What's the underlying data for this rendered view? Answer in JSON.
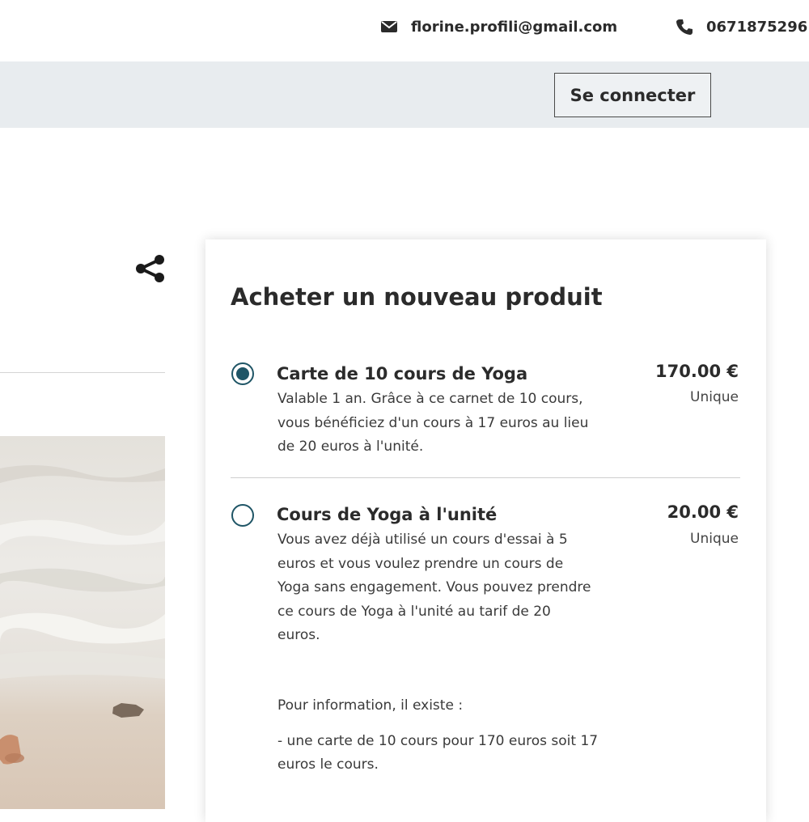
{
  "topbar": {
    "email": "florine.profili@gmail.com",
    "phone": "0671875296",
    "email_icon": "envelope-icon",
    "phone_icon": "phone-icon"
  },
  "navbar": {
    "login_label": "Se connecter"
  },
  "share_icon": "share-icon",
  "purchase": {
    "title": "Acheter un nouveau produit",
    "products": [
      {
        "name": "Carte de 10 cours de Yoga",
        "price": "170.00 €",
        "frequency": "Unique",
        "selected": true,
        "description": [
          "Valable 1 an. Grâce à ce carnet de 10 cours,",
          "vous bénéficiez d'un cours à 17 euros au lieu",
          "de 20 euros à l'unité."
        ]
      },
      {
        "name": "Cours de Yoga à l'unité",
        "price": "20.00 €",
        "frequency": "Unique",
        "selected": false,
        "description": [
          "Vous avez déjà utilisé un cours d'essai à 5",
          "euros et vous voulez prendre un cours de",
          "Yoga sans engagement. Vous pouvez prendre",
          "ce cours de Yoga à l'unité au tarif de 20",
          "euros."
        ],
        "info_title": "Pour information, il existe :",
        "info_lines": [
          "- une carte de 10 cours pour 170 euros soit 17",
          "euros le cours."
        ]
      }
    ]
  },
  "colors": {
    "accent": "#1f5566",
    "navbar_bg": "#e8ecef",
    "text": "#2b2b2b"
  }
}
